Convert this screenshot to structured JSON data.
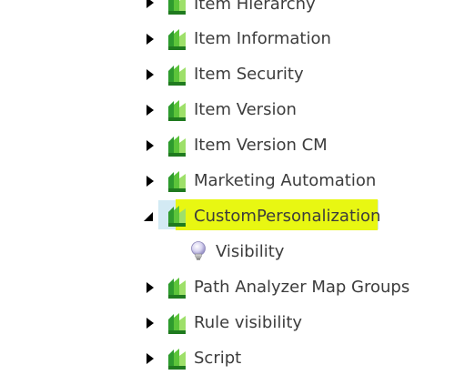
{
  "colors": {
    "text": "#3c3c3c",
    "selection": "#d3eaf4",
    "highlighter": "#e8f712",
    "icon_green": "#2e9b2e",
    "icon_light": "#88dd44"
  },
  "tree": {
    "items": [
      {
        "label": "Item Hierarchy",
        "expanded": false,
        "icon": "sitecore-template-icon"
      },
      {
        "label": "Item Information",
        "expanded": false,
        "icon": "sitecore-template-icon"
      },
      {
        "label": "Item Security",
        "expanded": false,
        "icon": "sitecore-template-icon"
      },
      {
        "label": "Item Version",
        "expanded": false,
        "icon": "sitecore-template-icon"
      },
      {
        "label": "Item Version CM",
        "expanded": false,
        "icon": "sitecore-template-icon"
      },
      {
        "label": "Marketing Automation",
        "expanded": false,
        "icon": "sitecore-template-icon"
      },
      {
        "label": "CustomPersonalization",
        "expanded": true,
        "selected": true,
        "icon": "sitecore-template-icon",
        "children": [
          {
            "label": "Visibility",
            "icon": "lightbulb-icon"
          }
        ]
      },
      {
        "label": "Path Analyzer Map Groups",
        "expanded": false,
        "icon": "sitecore-template-icon"
      },
      {
        "label": "Rule visibility",
        "expanded": false,
        "icon": "sitecore-template-icon"
      },
      {
        "label": "Script",
        "expanded": false,
        "icon": "sitecore-template-icon"
      }
    ]
  }
}
